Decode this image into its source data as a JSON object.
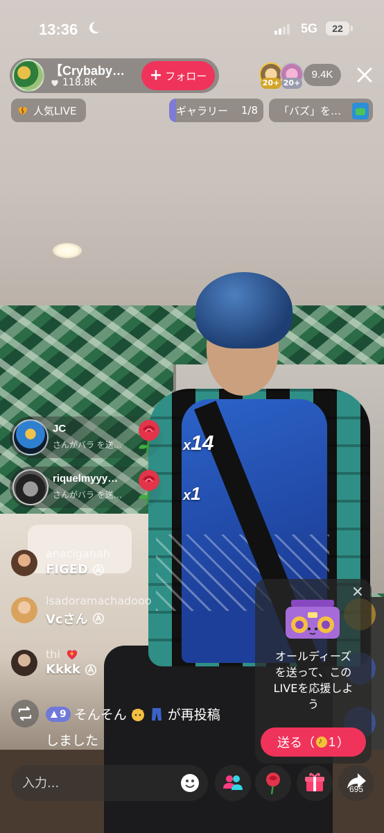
{
  "status_bar": {
    "time": "13:36",
    "network": "5G",
    "battery": "22"
  },
  "host": {
    "name": "【Crybaby…",
    "likes": "118.8K",
    "follow_label": "フォロー"
  },
  "viewers": {
    "badge_1": "20+",
    "badge_2": "20+",
    "count": "9.4K"
  },
  "chips": {
    "popular_label": "人気LIVE",
    "gallery_label": "ギャラリー",
    "gallery_page": "1/8",
    "buzz_label": "「バズ」を…"
  },
  "gifts": [
    {
      "user": "JC",
      "text": "さんがバラ を送…",
      "count_prefix": "x",
      "count": "14"
    },
    {
      "user": "riquelmyyy…",
      "text": "さんがバラ を送…",
      "count_prefix": "x",
      "count": "1"
    }
  ],
  "comments": [
    {
      "user": "anaciganah",
      "text": "FIGED"
    },
    {
      "user": "lsadoramachadooo",
      "text": "Vcさん"
    },
    {
      "user": "thi",
      "text": "Kkkk"
    }
  ],
  "repost": {
    "tier_level": "9",
    "user": "そんそん",
    "suffix": "が再投稿",
    "line2": "しました"
  },
  "promo": {
    "text": "オールディーズ\nを送って、この\nLIVEを応援しよ\nう",
    "send_label": "送る（",
    "send_cost": "1",
    "send_close": "）"
  },
  "bottom": {
    "input_placeholder": "入力...",
    "share_count": "695"
  }
}
